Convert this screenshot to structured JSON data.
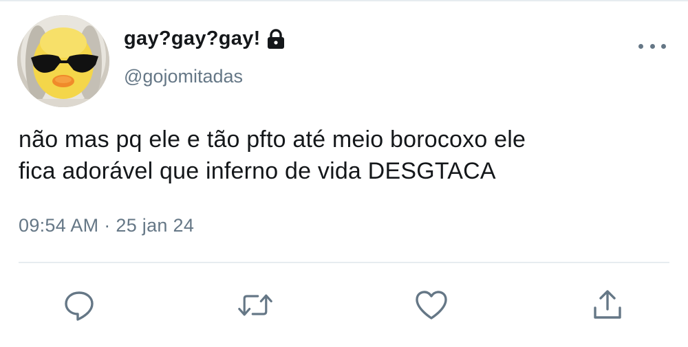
{
  "tweet": {
    "display_name": "gay?gay?gay!",
    "handle": "@gojomitadas",
    "text_lines": [
      "não mas pq ele e tão pfto até meio borocoxo ele",
      "fica adorável que inferno de vida DESGTACA"
    ],
    "timestamp": "09:54 AM · 25 jan 24",
    "protected": true
  },
  "icons": {
    "lock": "lock-icon",
    "more": "more-dots-icon",
    "reply": "reply-icon",
    "retweet": "retweet-icon",
    "like": "heart-icon",
    "share": "share-icon"
  },
  "colors": {
    "text": "#14171a",
    "secondary": "#657786",
    "divider": "#e6ecf0"
  }
}
